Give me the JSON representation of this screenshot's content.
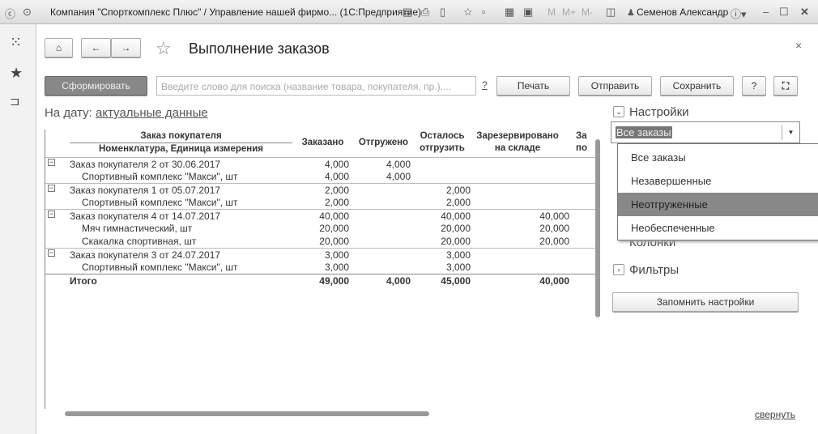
{
  "window": {
    "title": "Компания \"Спорткомплекс Плюс\" / Управление нашей фирмо...  (1С:Предприятие)",
    "user": "Семенов Александр",
    "m_buttons": [
      "M",
      "M+",
      "M-"
    ]
  },
  "header": {
    "title": "Выполнение заказов"
  },
  "toolbar": {
    "generate": "Сформировать",
    "search_placeholder": "Введите слово для поиска (название товара, покупателя, пр.)....",
    "search_help": "?",
    "print": "Печать",
    "send": "Отправить",
    "save": "Сохранить",
    "help": "?"
  },
  "ondate": {
    "label": "На дату:",
    "value": "актуальные данные"
  },
  "table": {
    "headers": {
      "group": "Заказ покупателя",
      "item": "Номенклатура, Единица измерения",
      "ordered": "Заказано",
      "shipped": "Отгружено",
      "remaining": "Осталось отгрузить",
      "reserved": "Зарезервировано на складе",
      "cut": "За по"
    },
    "rows": [
      {
        "name": "Заказ покупателя 2 от 30.06.2017",
        "group": true,
        "ordered": "4,000",
        "shipped": "4,000",
        "remaining": "",
        "reserved": ""
      },
      {
        "name": "Спортивный комплекс \"Макси\", шт",
        "group": false,
        "ordered": "4,000",
        "shipped": "4,000",
        "remaining": "",
        "reserved": ""
      },
      {
        "name": "Заказ покупателя 1 от 05.07.2017",
        "group": true,
        "ordered": "2,000",
        "shipped": "",
        "remaining": "2,000",
        "reserved": ""
      },
      {
        "name": "Спортивный комплекс \"Макси\", шт",
        "group": false,
        "ordered": "2,000",
        "shipped": "",
        "remaining": "2,000",
        "reserved": ""
      },
      {
        "name": "Заказ покупателя 4 от 14.07.2017",
        "group": true,
        "ordered": "40,000",
        "shipped": "",
        "remaining": "40,000",
        "reserved": "40,000"
      },
      {
        "name": "Мяч гимнастический, шт",
        "group": false,
        "ordered": "20,000",
        "shipped": "",
        "remaining": "20,000",
        "reserved": "20,000"
      },
      {
        "name": "Скакалка спортивная, шт",
        "group": false,
        "ordered": "20,000",
        "shipped": "",
        "remaining": "20,000",
        "reserved": "20,000"
      },
      {
        "name": "Заказ покупателя 3 от 24.07.2017",
        "group": true,
        "ordered": "3,000",
        "shipped": "",
        "remaining": "3,000",
        "reserved": ""
      },
      {
        "name": "Спортивный комплекс \"Макси\", шт",
        "group": false,
        "ordered": "3,000",
        "shipped": "",
        "remaining": "3,000",
        "reserved": ""
      }
    ],
    "total": {
      "name": "Итого",
      "ordered": "49,000",
      "shipped": "4,000",
      "remaining": "45,000",
      "reserved": "40,000"
    }
  },
  "settings": {
    "title": "Настройки",
    "selected": "Все заказы",
    "options": [
      "Все заказы",
      "Незавершенные",
      "Неотгруженные",
      "Необеспеченные"
    ],
    "highlighted_index": 2,
    "columns": "Колонки",
    "filters": "Фильтры",
    "remember": "Запомнить настройки"
  },
  "footer": {
    "collapse": "свернуть"
  }
}
